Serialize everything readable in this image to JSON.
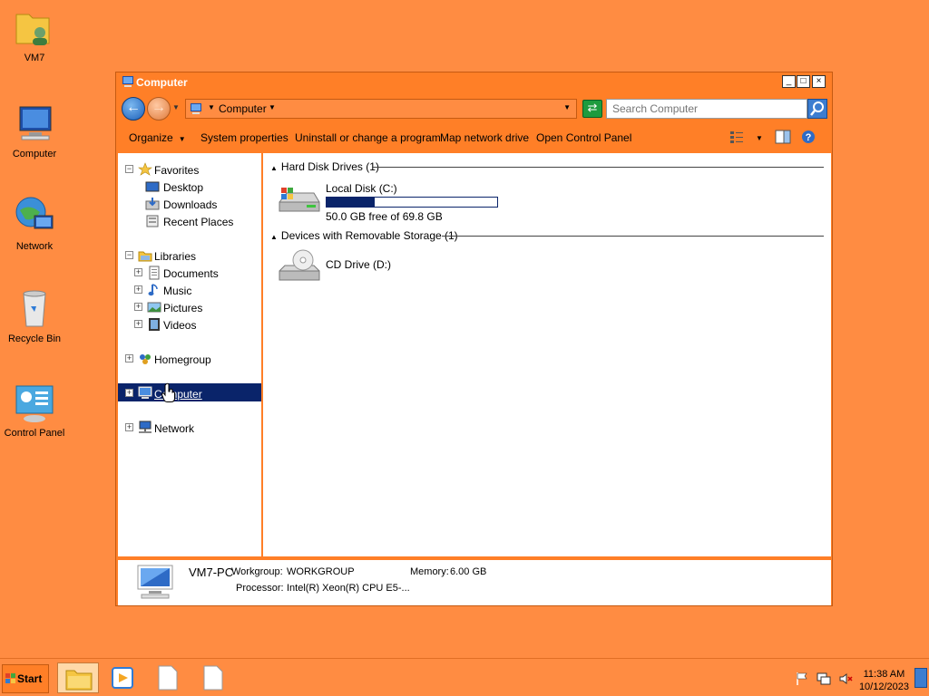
{
  "desktop": {
    "icons": [
      {
        "label": "VM7",
        "icon": "user-folder-icon"
      },
      {
        "label": "Computer",
        "icon": "computer-icon"
      },
      {
        "label": "Network",
        "icon": "network-icon"
      },
      {
        "label": "Recycle Bin",
        "icon": "recycle-bin-icon"
      },
      {
        "label": "Control Panel",
        "icon": "control-panel-icon"
      }
    ]
  },
  "window": {
    "title": "Computer",
    "controls": {
      "minimize": "_",
      "maximize": "□",
      "close": "×"
    },
    "address": {
      "path": "Computer"
    },
    "search": {
      "placeholder": "Search Computer"
    },
    "toolbar": {
      "organize": "Organize",
      "system_properties": "System properties",
      "uninstall": "Uninstall or change a program",
      "map_drive": "Map network drive",
      "control_panel": "Open Control Panel"
    },
    "nav": {
      "favorites": "Favorites",
      "desktop": "Desktop",
      "downloads": "Downloads",
      "recent": "Recent Places",
      "libraries": "Libraries",
      "documents": "Documents",
      "music": "Music",
      "pictures": "Pictures",
      "videos": "Videos",
      "homegroup": "Homegroup",
      "computer": "Computer",
      "network": "Network"
    },
    "content": {
      "hdd_group": "Hard Disk Drives (1)",
      "removable_group": "Devices with Removable Storage (1)",
      "local_disk": {
        "name": "Local Disk (C:)",
        "free_text": "50.0 GB free of 69.8 GB",
        "used_fraction": 0.284
      },
      "cd_drive": {
        "name": "CD Drive (D:)"
      }
    },
    "details": {
      "pc_name": "VM7-PC",
      "workgroup_label": "Workgroup:",
      "workgroup": "WORKGROUP",
      "memory_label": "Memory:",
      "memory": "6.00 GB",
      "processor_label": "Processor:",
      "processor": "Intel(R) Xeon(R) CPU E5-..."
    }
  },
  "taskbar": {
    "start": "Start",
    "time": "11:38 AM",
    "date": "10/12/2023"
  },
  "colors": {
    "desktop_bg": "#FF8C42",
    "window_frame": "#FF7F27",
    "selection": "#0A246A"
  }
}
